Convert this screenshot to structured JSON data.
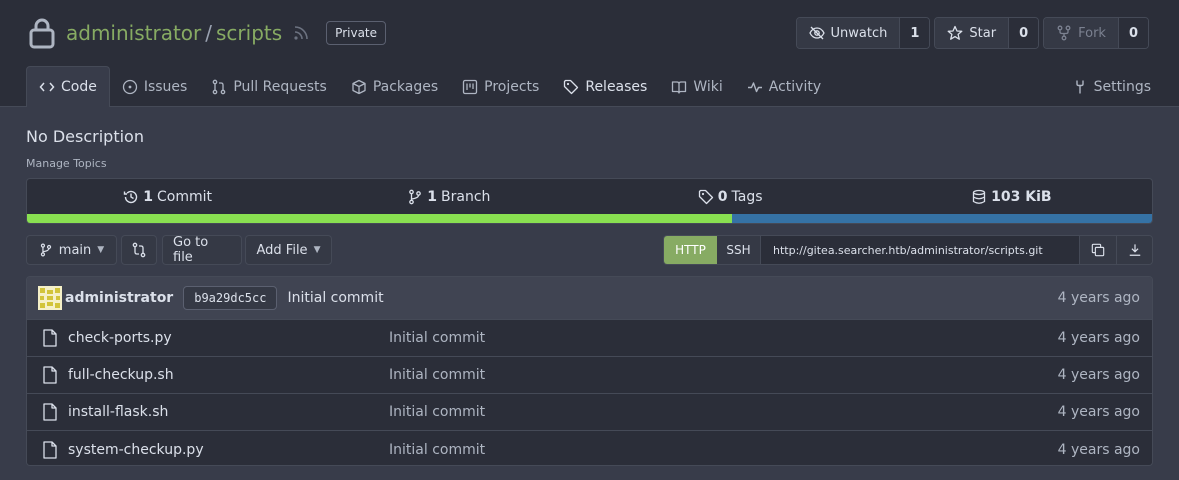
{
  "repo": {
    "owner": "administrator",
    "separator": "/",
    "name": "scripts",
    "visibility": "Private"
  },
  "actions": {
    "watch": {
      "label": "Unwatch",
      "count": "1"
    },
    "star": {
      "label": "Star",
      "count": "0"
    },
    "fork": {
      "label": "Fork",
      "count": "0"
    }
  },
  "tabs": [
    {
      "label": "Code",
      "icon": "code-icon"
    },
    {
      "label": "Issues",
      "icon": "issue-icon"
    },
    {
      "label": "Pull Requests",
      "icon": "pull-request-icon"
    },
    {
      "label": "Packages",
      "icon": "package-icon"
    },
    {
      "label": "Projects",
      "icon": "project-icon"
    },
    {
      "label": "Releases",
      "icon": "tag-icon"
    },
    {
      "label": "Wiki",
      "icon": "book-icon"
    },
    {
      "label": "Activity",
      "icon": "pulse-icon"
    }
  ],
  "settings_label": "Settings",
  "description": "No Description",
  "manage_topics": "Manage Topics",
  "stats": {
    "commits": {
      "count": "1",
      "label": "Commit"
    },
    "branches": {
      "count": "1",
      "label": "Branch"
    },
    "tags": {
      "count": "0",
      "label": "Tags"
    },
    "size": {
      "value": "103 KiB"
    }
  },
  "languages": {
    "first_share": 0.627,
    "colors": [
      "#89e051",
      "#3572a5"
    ]
  },
  "toolbar": {
    "branch": "main",
    "go_to_file": "Go to file",
    "add_file": "Add File",
    "http": "HTTP",
    "ssh": "SSH",
    "clone_url": "http://gitea.searcher.htb/administrator/scripts.git"
  },
  "latest_commit": {
    "author": "administrator",
    "sha": "b9a29dc5cc",
    "message": "Initial commit",
    "when": "4 years ago"
  },
  "files": [
    {
      "name": "check-ports.py",
      "message": "Initial commit",
      "when": "4 years ago"
    },
    {
      "name": "full-checkup.sh",
      "message": "Initial commit",
      "when": "4 years ago"
    },
    {
      "name": "install-flask.sh",
      "message": "Initial commit",
      "when": "4 years ago"
    },
    {
      "name": "system-checkup.py",
      "message": "Initial commit",
      "when": "4 years ago"
    }
  ],
  "colors": {
    "accent": "#87ab63",
    "background": "#383c4a",
    "header": "#2b2e39"
  }
}
